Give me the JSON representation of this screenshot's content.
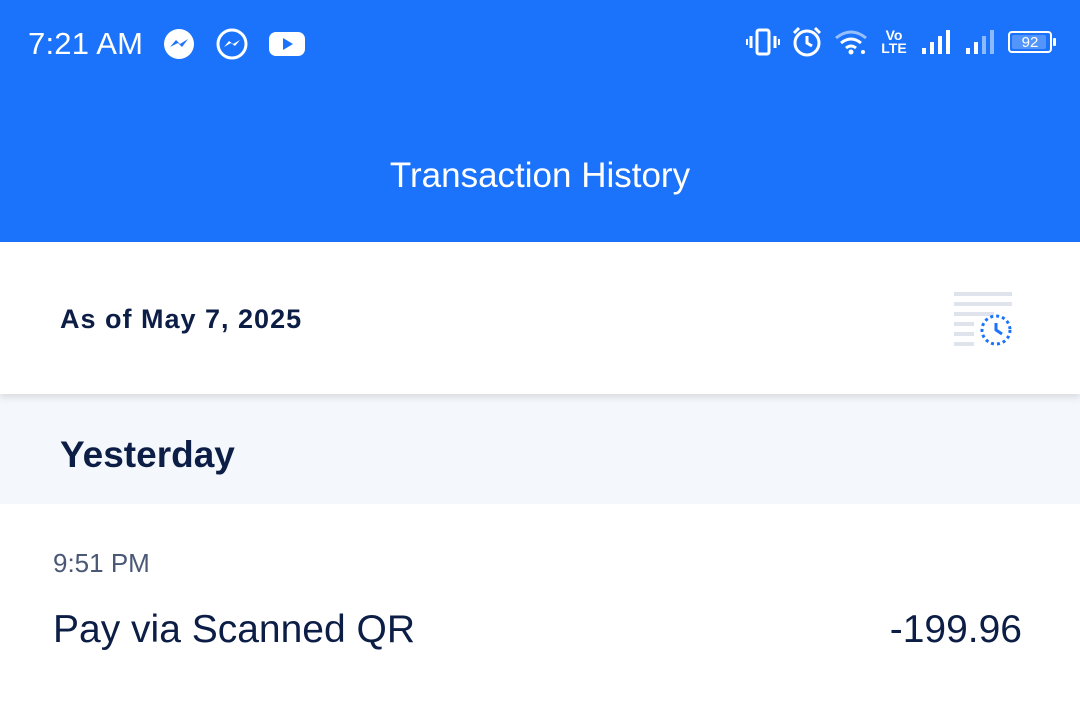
{
  "status_bar": {
    "time": "7:21 AM",
    "left_icons": [
      "messenger-icon",
      "messenger-outline-icon",
      "youtube-icon"
    ],
    "right_icons": [
      "vibrate-icon",
      "alarm-icon",
      "wifi-icon",
      "volte-icon",
      "signal-icon",
      "signal-icon-2",
      "battery-icon"
    ],
    "volte_top": "Vo",
    "volte_bottom": "LTE",
    "battery_level": "92"
  },
  "header": {
    "title": "Transaction History",
    "color": "#1b72fb"
  },
  "date_bar": {
    "as_of_text": "As of May 7, 2025",
    "action_icon": "history-list-icon"
  },
  "sections": [
    {
      "label": "Yesterday",
      "transactions": [
        {
          "time": "9:51 PM",
          "title": "Pay via Scanned QR",
          "amount": "-199.96"
        }
      ]
    }
  ],
  "colors": {
    "text_dark": "#0c1e45",
    "text_muted": "#4a5876",
    "section_bg": "#f4f7fb"
  }
}
